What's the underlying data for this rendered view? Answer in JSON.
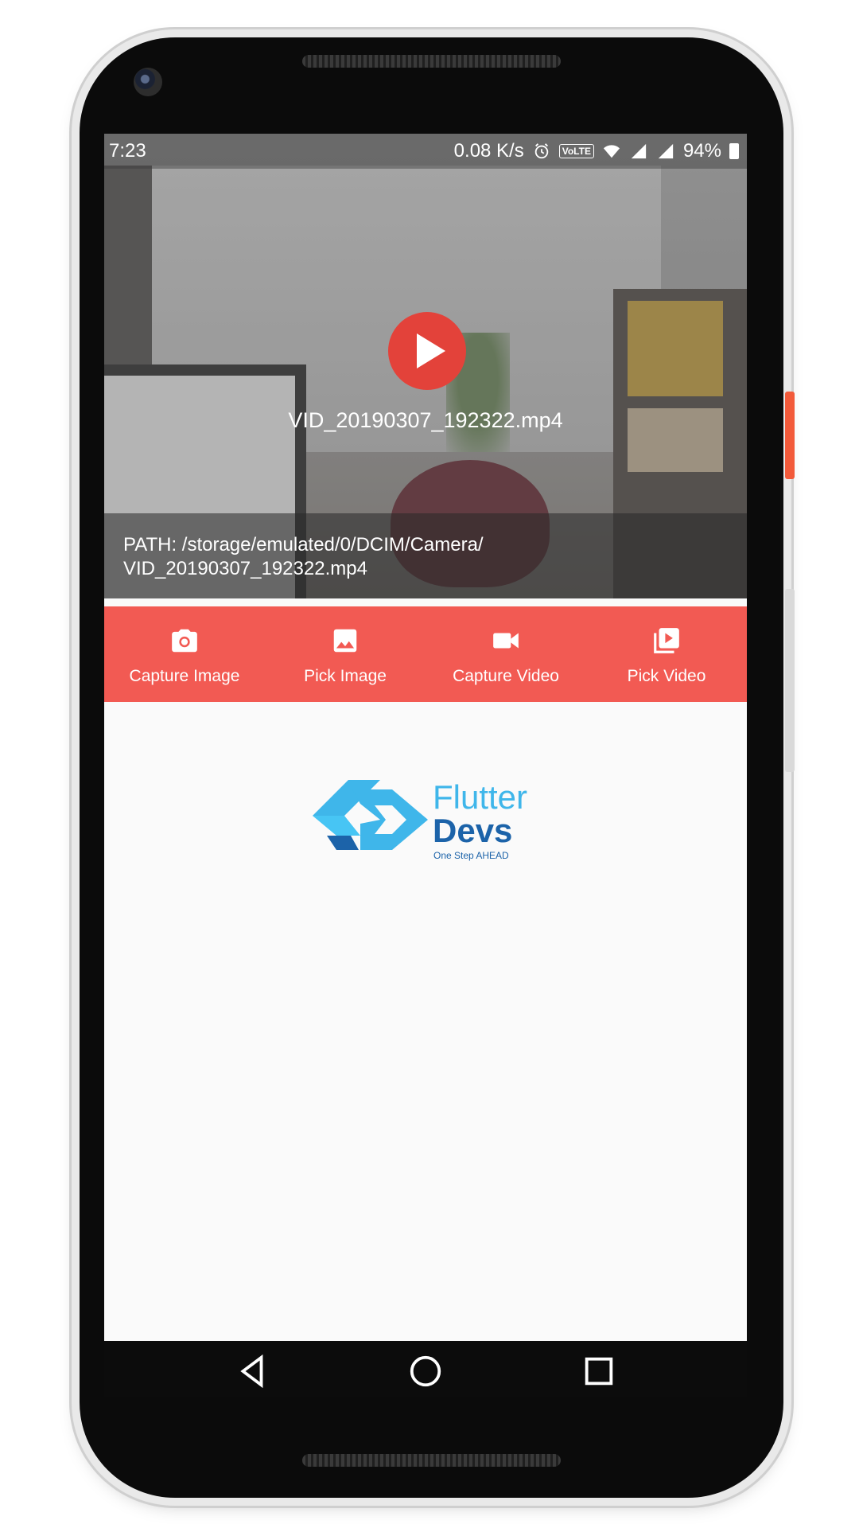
{
  "status_bar": {
    "time": "7:23",
    "net_speed": "0.08 K/s",
    "volte": "VoLTE",
    "battery": "94%"
  },
  "video": {
    "file_name": "VID_20190307_192322.mp4",
    "path_line1": "PATH: /storage/emulated/0/DCIM/Camera/",
    "path_line2": "VID_20190307_192322.mp4"
  },
  "toolbar": {
    "items": [
      {
        "label": "Capture Image",
        "icon": "camera-icon"
      },
      {
        "label": "Pick Image",
        "icon": "image-icon"
      },
      {
        "label": "Capture Video",
        "icon": "videocam-icon"
      },
      {
        "label": "Pick Video",
        "icon": "video-library-icon"
      }
    ]
  },
  "logo": {
    "line1": "Flutter",
    "line2": "Devs",
    "tagline": "One Step AHEAD"
  },
  "colors": {
    "accent": "#f25a53",
    "play": "#e3423a",
    "logo_light": "#3fb6ea",
    "logo_dark": "#1c63a9"
  }
}
